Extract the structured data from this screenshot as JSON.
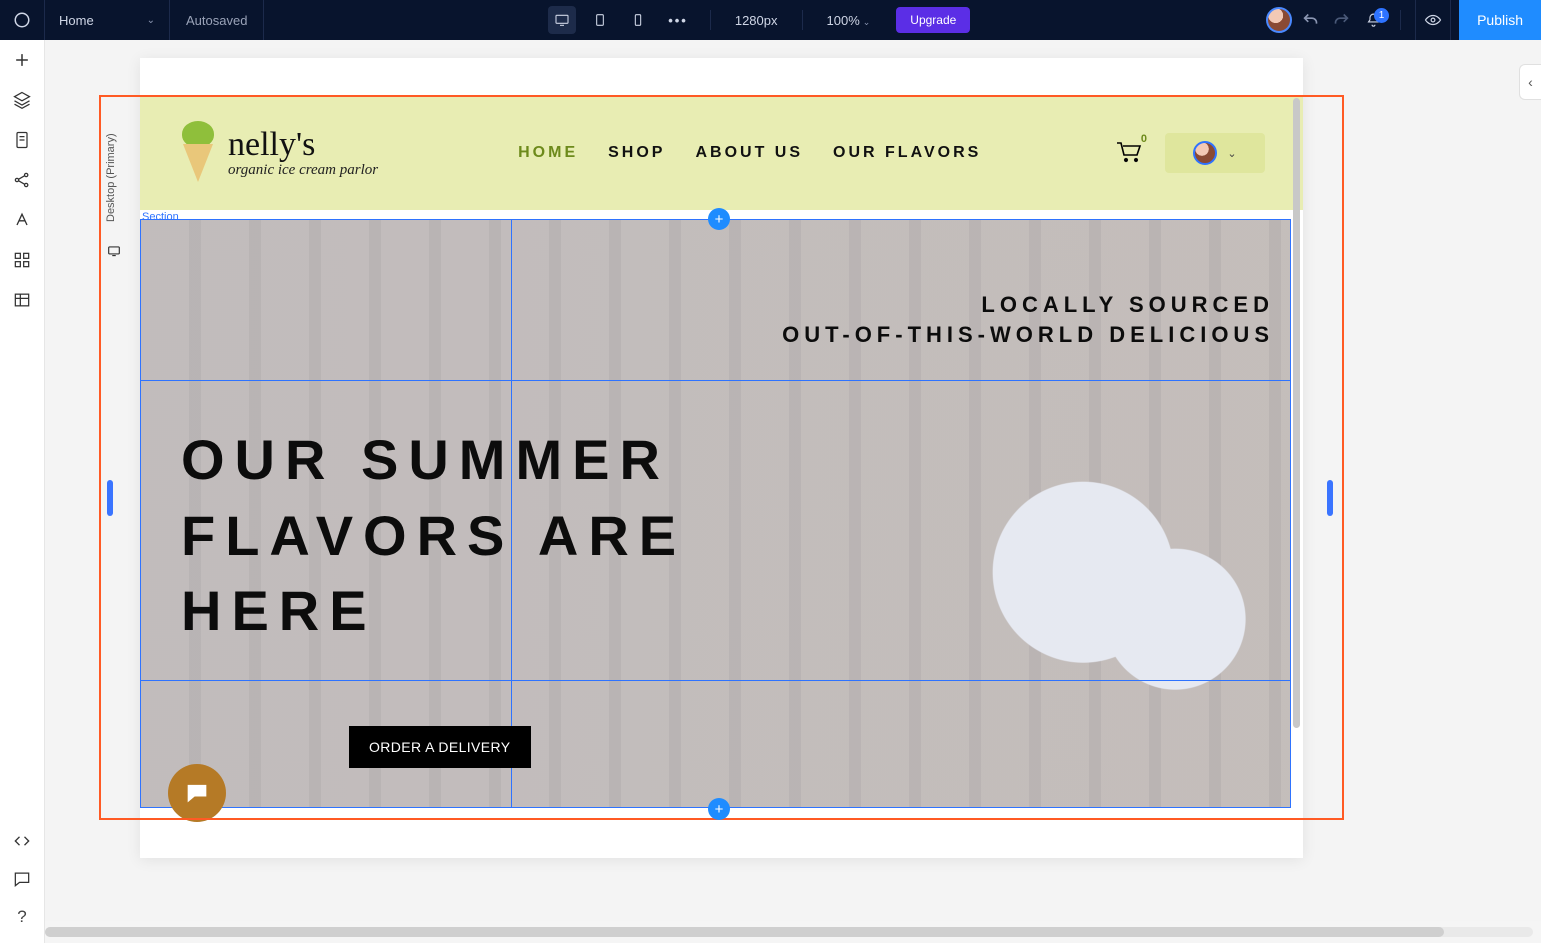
{
  "topbar": {
    "page_name": "Home",
    "save_status": "Autosaved",
    "viewport_size": "1280px",
    "zoom": "100%",
    "upgrade_label": "Upgrade",
    "notifications_count": "1",
    "publish_label": "Publish"
  },
  "breakpoint_label": "Desktop (Primary)",
  "selection_label": "Section",
  "site": {
    "brand_name": "nelly's",
    "brand_tagline": "organic ice cream parlor",
    "nav": {
      "home": "HOME",
      "shop": "SHOP",
      "about": "ABOUT US",
      "flavors": "OUR FLAVORS"
    },
    "cart_count": "0",
    "hero_tagline_line1": "LOCALLY SOURCED",
    "hero_tagline_line2": "OUT-OF-THIS-WORLD DELICIOUS",
    "hero_heading": "OUR SUMMER FLAVORS ARE HERE",
    "order_button": "ORDER A DELIVERY"
  },
  "add_glyph": "+",
  "more_glyph": "•••",
  "help_glyph": "?",
  "chevron_down": "⌄",
  "chevron_left": "‹"
}
